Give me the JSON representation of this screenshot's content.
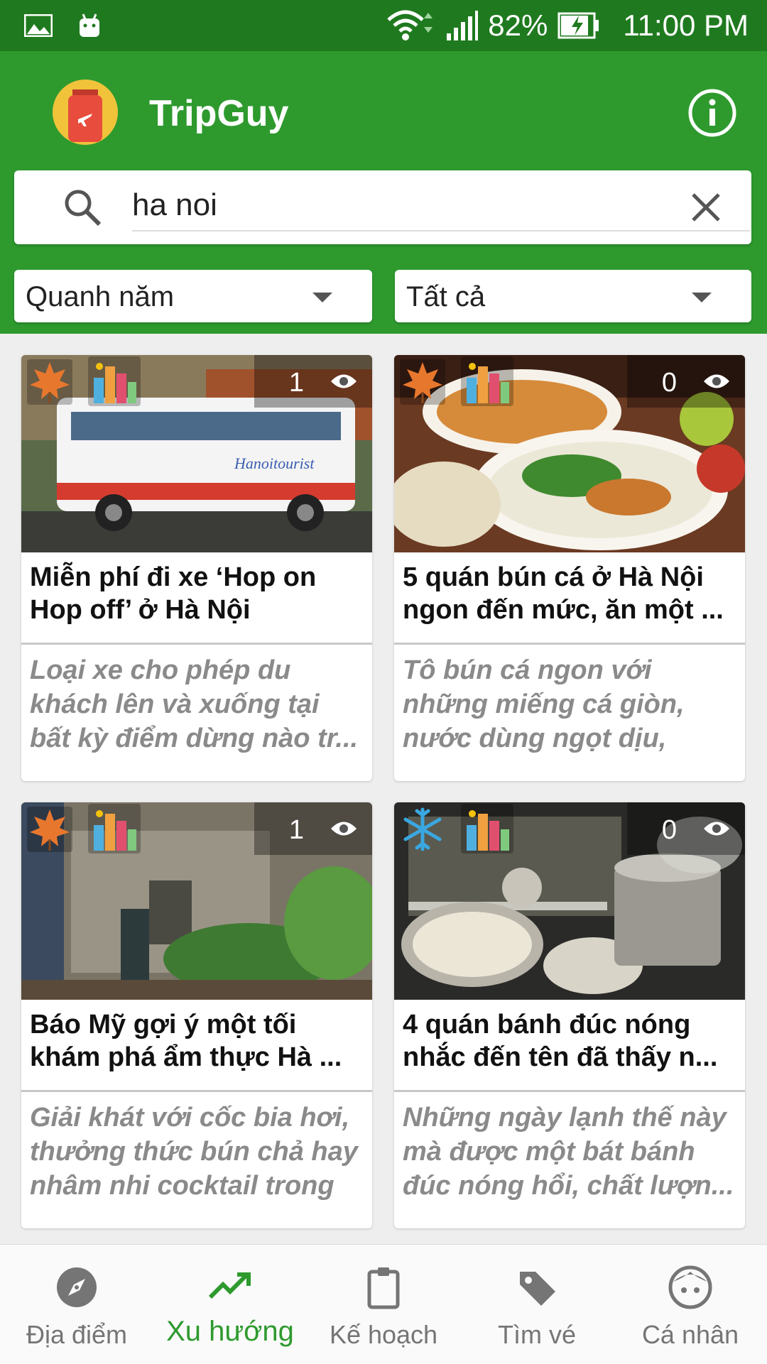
{
  "status_bar": {
    "battery": "82%",
    "time": "11:00 PM"
  },
  "app": {
    "title": "TripGuy"
  },
  "search": {
    "query": "ha noi"
  },
  "filters": {
    "season": "Quanh năm",
    "category": "Tất cả"
  },
  "cards": [
    {
      "title": "Miễn phí đi xe ‘Hop on Hop off’ ở Hà Nội",
      "description": "Loại xe cho phép du khách lên và xuống tại bất kỳ điểm dừng nào tr...",
      "views": "1",
      "season_icon": "autumn-leaf-icon"
    },
    {
      "title": "5 quán bún cá ở Hà Nội ngon đến mức, ăn một ...",
      "description": "Tô bún cá ngon với những miếng cá giòn, nước dùng ngọt dịu, điểm thê...",
      "views": "0",
      "season_icon": "autumn-leaf-icon"
    },
    {
      "title": "Báo Mỹ gợi ý một tối khám phá ẩm thực Hà ...",
      "description": "Giải khát với cốc bia hơi, thưởng thức bún chả hay nhâm nhi cocktail trong ...",
      "views": "1",
      "season_icon": "autumn-leaf-icon"
    },
    {
      "title": "4 quán bánh đúc nóng nhắc đến tên đã thấy n...",
      "description": "Những ngày lạnh thế này mà được một bát bánh đúc nóng hổi, chất lượn...",
      "views": "0",
      "season_icon": "snowflake-icon"
    }
  ],
  "bottom_nav": [
    {
      "label": "Địa điểm",
      "icon": "compass-icon",
      "active": false
    },
    {
      "label": "Xu hướng",
      "icon": "trending-icon",
      "active": true
    },
    {
      "label": "Kế hoạch",
      "icon": "clipboard-icon",
      "active": false
    },
    {
      "label": "Tìm vé",
      "icon": "tag-icon",
      "active": false
    },
    {
      "label": "Cá nhân",
      "icon": "profile-face-icon",
      "active": false
    }
  ],
  "colors": {
    "primary": "#2e9a2e",
    "status_bar": "#1f7a1f"
  }
}
